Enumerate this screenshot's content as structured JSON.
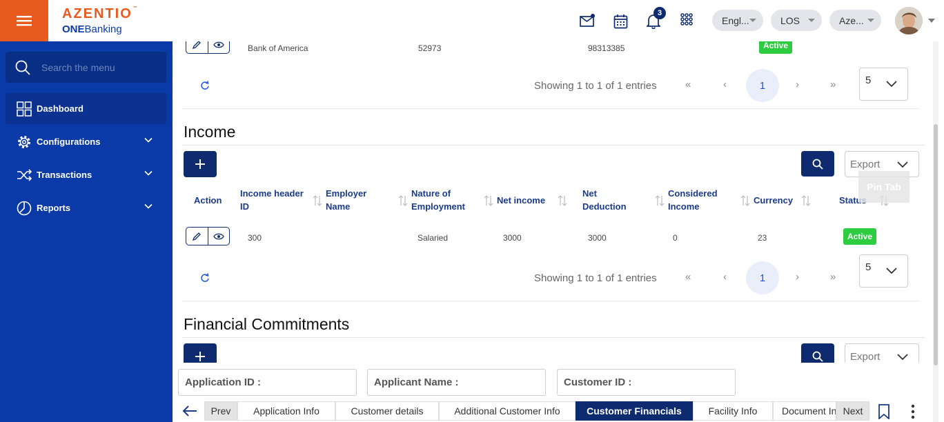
{
  "brand": {
    "line1": "AZENTIO",
    "tm": "™",
    "line2_bold": "ONE",
    "line2": "Banking"
  },
  "search": {
    "placeholder": "Search the menu"
  },
  "sidebar": {
    "items": [
      {
        "label": "Dashboard"
      },
      {
        "label": "Configurations"
      },
      {
        "label": "Transactions"
      },
      {
        "label": "Reports"
      }
    ]
  },
  "topbar": {
    "notification_count": "3",
    "lang": "Engl...",
    "module": "LOS",
    "entity": "Aze..."
  },
  "prev_table": {
    "row": [
      "Bank of America",
      "52973",
      "98313385"
    ],
    "status": "Active",
    "info": "Showing 1 to 1 of 1 entries",
    "page": "1",
    "page_size": "5"
  },
  "income": {
    "title": "Income",
    "export": "Export",
    "headers": [
      "Action",
      "Income header ID",
      "Employer Name",
      "Nature of Employment",
      "Net income",
      "Net Deduction",
      "Considered Income",
      "Currency",
      "Status"
    ],
    "row": [
      "300",
      "",
      "Salaried",
      "3000",
      "3000",
      "0",
      "23"
    ],
    "status": "Active",
    "info": "Showing 1 to 1 of 1 entries",
    "page": "1",
    "page_size": "5"
  },
  "commitments": {
    "title": "Financial Commitments",
    "export": "Export"
  },
  "pin_tab": "Pin Tab",
  "info_fields": {
    "application_id": "Application ID :",
    "applicant_name": "Applicant Name :",
    "customer_id": "Customer ID :"
  },
  "tabs": {
    "prev": "Prev",
    "next": "Next",
    "items": [
      "Application Info",
      "Customer details",
      "Additional Customer Info",
      "Customer Financials",
      "Facility Info",
      "Document Info"
    ],
    "current": "Customer Financials"
  },
  "colors": {
    "sidebar": "#0a3aa8",
    "accent": "#e95a1e",
    "primary": "#0d2b6e",
    "active": "#2ecc40"
  }
}
